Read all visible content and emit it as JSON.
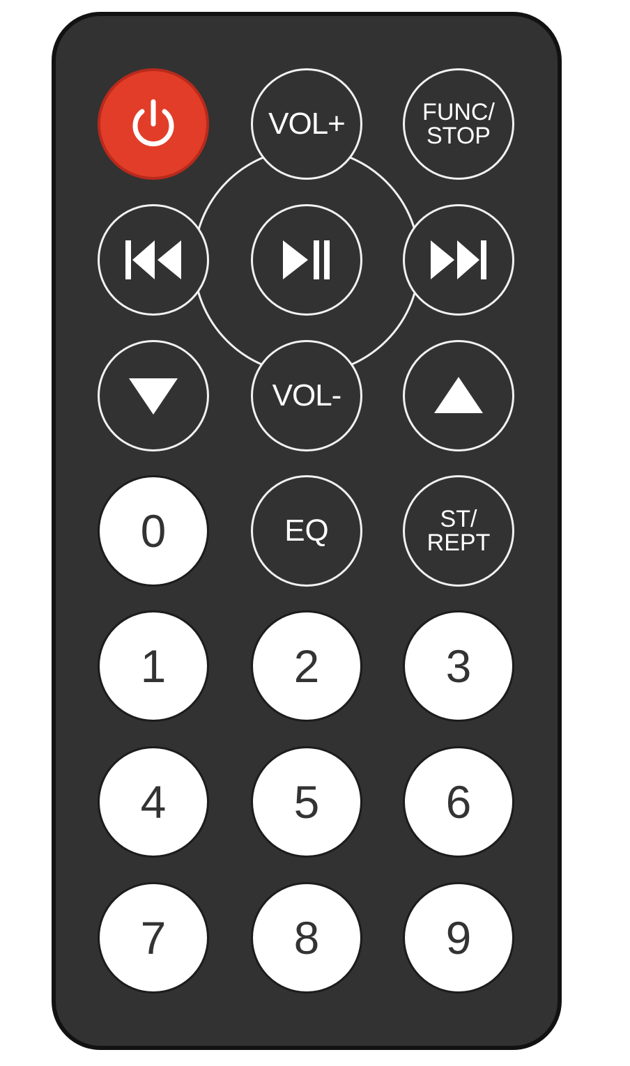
{
  "remote": {
    "body_color": "#323232",
    "accent_power": "#e23d28"
  },
  "buttons": {
    "power": {
      "icon": "power-icon"
    },
    "vol_up": {
      "label": "VOL+"
    },
    "func_stop": {
      "line1": "FUNC/",
      "line2": "STOP"
    },
    "prev": {
      "icon": "skip-back-icon"
    },
    "play_pause": {
      "icon": "play-pause-icon"
    },
    "next": {
      "icon": "skip-forward-icon"
    },
    "down": {
      "icon": "triangle-down-icon"
    },
    "vol_down": {
      "label": "VOL-"
    },
    "up": {
      "icon": "triangle-up-icon"
    },
    "zero": {
      "label": "0"
    },
    "eq": {
      "label": "EQ"
    },
    "st_rept": {
      "line1": "ST/",
      "line2": "REPT"
    },
    "digits": [
      "1",
      "2",
      "3",
      "4",
      "5",
      "6",
      "7",
      "8",
      "9"
    ]
  }
}
